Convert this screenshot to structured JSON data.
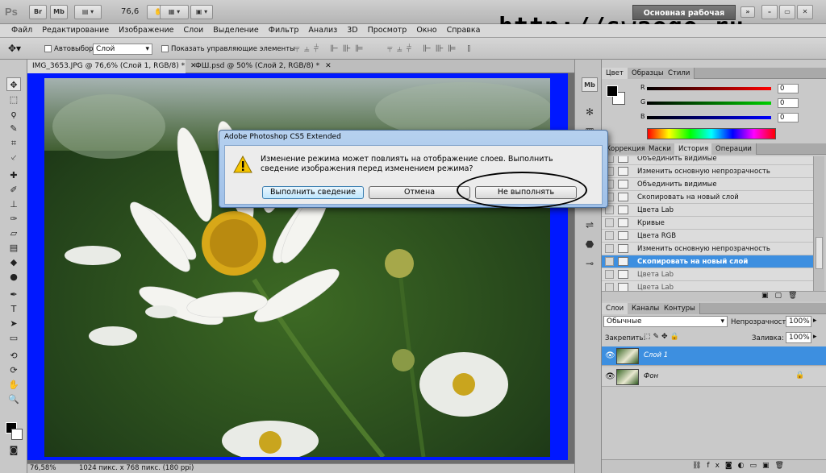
{
  "app": {
    "logo": "Ps",
    "zoom": "76,6",
    "workspace_button": "Основная рабочая среда",
    "watermark": "http://swaego.ru",
    "toolbar_buttons": [
      "Br",
      "Mb"
    ]
  },
  "menu": [
    "Файл",
    "Редактирование",
    "Изображение",
    "Слои",
    "Выделение",
    "Фильтр",
    "Анализ",
    "3D",
    "Просмотр",
    "Окно",
    "Справка"
  ],
  "options": {
    "autoselect_label": "Автовыбор:",
    "autoselect_value": "Слой",
    "show_transform_label": "Показать управляющие элементы"
  },
  "tabs": [
    {
      "label": "IMG_3653.JPG @ 76,6% (Слой 1, RGB/8) *",
      "active": true
    },
    {
      "label": "ФШ.psd @ 50% (Слой 2, RGB/8) *",
      "active": false
    }
  ],
  "status": {
    "zoom": "76,58%",
    "doc_size": "1024 пикс. x 768 пикс. (180 ppi)"
  },
  "color_panel": {
    "tabs": [
      "Цвет",
      "Образцы",
      "Стили"
    ],
    "channels": [
      {
        "label": "R",
        "value": "0",
        "color": "#ff0000"
      },
      {
        "label": "G",
        "value": "0",
        "color": "#00c000"
      },
      {
        "label": "B",
        "value": "0",
        "color": "#0000ff"
      }
    ]
  },
  "history_panel": {
    "tabs": [
      "Коррекция",
      "Маски",
      "История",
      "Операции"
    ],
    "items": [
      "Объединить видимые",
      "Изменить основную непрозрачность",
      "Объединить видимые",
      "Скопировать на новый слой",
      "Цвета Lab",
      "Кривые",
      "Цвета RGB",
      "Изменить основную непрозрачность",
      "Скопировать на новый слой",
      "Цвета Lab",
      "Цвета Lab"
    ],
    "selected_index": 8
  },
  "layers_panel": {
    "tabs": [
      "Слои",
      "Каналы",
      "Контуры"
    ],
    "blend_mode": "Обычные",
    "opacity_label": "Непрозрачность:",
    "opacity_value": "100%",
    "lock_label": "Закрепить:",
    "fill_label": "Заливка:",
    "fill_value": "100%",
    "layers": [
      {
        "name": "Слой 1",
        "selected": true
      },
      {
        "name": "Фон",
        "selected": false
      }
    ]
  },
  "dialog": {
    "title": "Adobe Photoshop CS5 Extended",
    "message": "Изменение режима может повлиять на отображение слоев. Выполнить сведение изображения перед изменением режима?",
    "buttons": [
      "Выполнить сведение",
      "Отмена",
      "Не выполнять"
    ]
  }
}
